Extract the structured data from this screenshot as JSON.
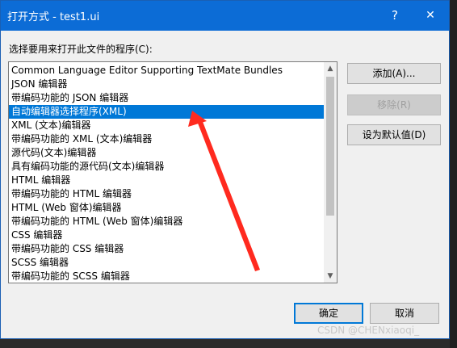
{
  "window": {
    "title": "打开方式 - test1.ui",
    "help": "?",
    "close": "✕"
  },
  "prompt": "选择要用来打开此文件的程序(C):",
  "list": {
    "items": [
      "Common Language Editor Supporting TextMate Bundles",
      "JSON 编辑器",
      "带编码功能的 JSON 编辑器",
      "自动编辑器选择程序(XML)",
      "XML (文本)编辑器",
      "带编码功能的 XML (文本)编辑器",
      "源代码(文本)编辑器",
      "具有编码功能的源代码(文本)编辑器",
      "HTML 编辑器",
      "带编码功能的 HTML 编辑器",
      "HTML (Web 窗体)编辑器",
      "带编码功能的 HTML (Web 窗体)编辑器",
      "CSS 编辑器",
      "带编码功能的 CSS 编辑器",
      "SCSS 编辑器",
      "带编码功能的 SCSS 编辑器"
    ],
    "selected_index": 3
  },
  "buttons": {
    "add": "添加(A)...",
    "remove": "移除(R)",
    "set_default": "设为默认值(D)",
    "ok": "确定",
    "cancel": "取消"
  },
  "watermark": "CSDN @CHENxiaoqi_",
  "colors": {
    "title_bar": "#0c6cd6",
    "selection": "#0078d7",
    "arrow": "#ff2a1f"
  }
}
